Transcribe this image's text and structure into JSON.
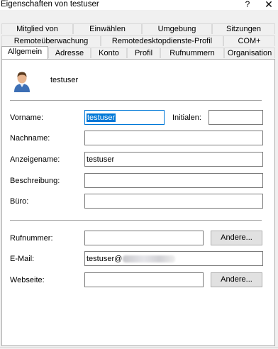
{
  "window": {
    "title": "Eigenschaften von testuser",
    "help_glyph": "?",
    "close_glyph": "✕"
  },
  "tabs": {
    "row1": [
      "Mitglied von",
      "Einwählen",
      "Umgebung",
      "Sitzungen"
    ],
    "row2": [
      "Remoteüberwachung",
      "Remotedesktopdienste-Profil",
      "COM+"
    ],
    "row3": [
      "Allgemein",
      "Adresse",
      "Konto",
      "Profil",
      "Rufnummern",
      "Organisation"
    ],
    "active": "Allgemein"
  },
  "general": {
    "display_user": "testuser",
    "labels": {
      "vorname": "Vorname:",
      "initialen": "Initialen:",
      "nachname": "Nachname:",
      "anzeigename": "Anzeigename:",
      "beschreibung": "Beschreibung:",
      "buero": "Büro:",
      "rufnummer": "Rufnummer:",
      "email": "E-Mail:",
      "webseite": "Webseite:"
    },
    "values": {
      "vorname": "testuser",
      "initialen": "",
      "nachname": "",
      "anzeigename": "testuser",
      "beschreibung": "",
      "buero": "",
      "rufnummer": "",
      "email_prefix": "testuser@",
      "webseite": ""
    },
    "buttons": {
      "andere_rufnummer": "Andere...",
      "andere_webseite": "Andere..."
    }
  },
  "colors": {
    "accent": "#0078d7",
    "panel": "#ffffff",
    "dialog": "#f0f0f0"
  }
}
